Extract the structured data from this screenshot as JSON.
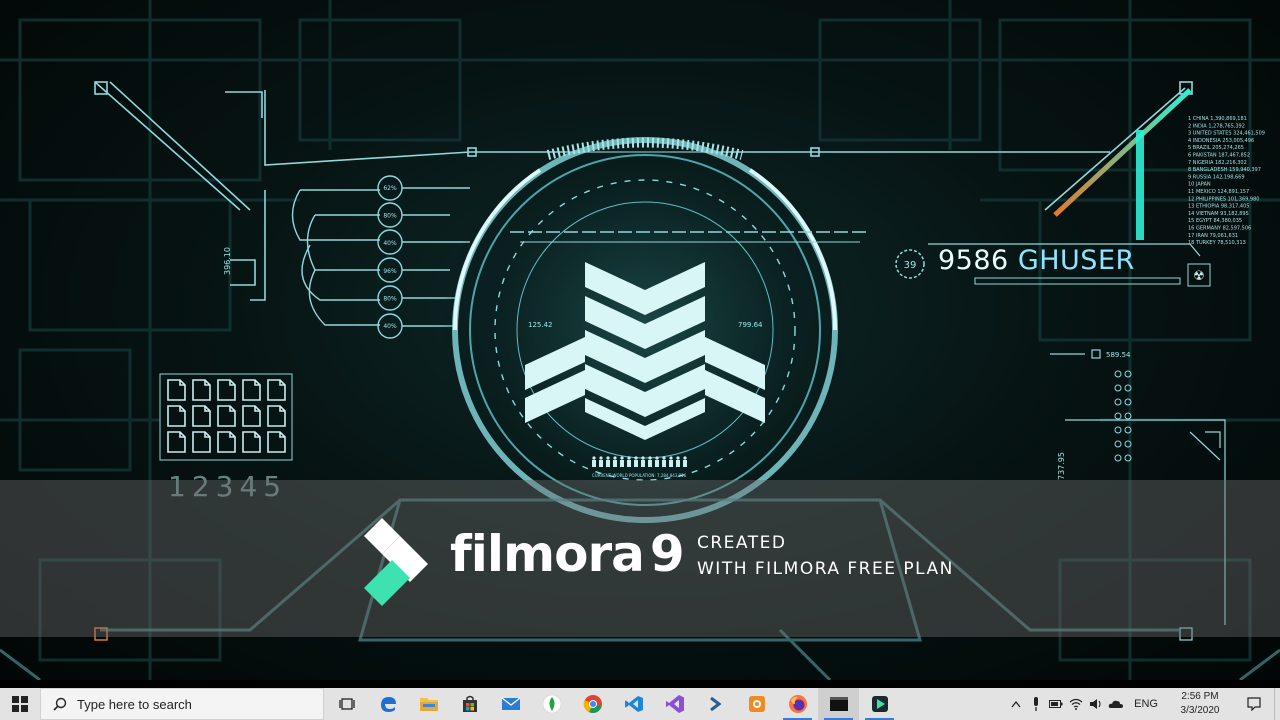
{
  "wallpaper": {
    "user_number": "9586",
    "user_name": "GHUSER",
    "level_badge": "39",
    "counter_digits": "12345",
    "left_readout": "125.42",
    "right_readout": "799.64",
    "side_value": "589.54",
    "vertical_left": "396.10",
    "vertical_right": "737.95",
    "percent_labels": [
      "62%",
      "80%",
      "40%",
      "96%",
      "80%",
      "40%"
    ],
    "population_caption": "CURRENT WORLD POPULATION: 7,284,843,916",
    "country_list": [
      "1 CHINA 1,390,869,181",
      "2 INDIA 1,278,765,392",
      "3 UNITED STATES 324,461,509",
      "4 INDONESIA 253,005,496",
      "5 BRAZIL 205,274,265",
      "6 PAKISTAN 187,467,852",
      "7 NIGERIA 182,216,302",
      "8 BANGLADESH 159,940,397",
      "9 RUSSIA 142,198,669",
      "10 JAPAN",
      "11 MEXICO 124,891,157",
      "12 PHILIPPINES 101,369,980",
      "13 ETHIOPIA 98,317,405",
      "14 VIETNAM 93,182,895",
      "15 EGYPT 84,380,035",
      "16 GERMANY 82,597,506",
      "17 IRAN 79,061,631",
      "18 TURKEY 78,510,313"
    ],
    "colors": {
      "hud_cyan": "#9fe3e6",
      "accent_teal": "#2ef0d6",
      "accent_orange": "#e07a2c"
    }
  },
  "watermark": {
    "brand": "filmora",
    "version": "9",
    "line1": "CREATED",
    "line2": "WITH FILMORA FREE PLAN",
    "colors": {
      "logo_white": "#ffffff",
      "logo_green": "#3ee2b0"
    }
  },
  "taskbar": {
    "start_icon": "windows-logo-icon",
    "search_placeholder": "Type here to search",
    "apps": [
      {
        "name": "task-view",
        "icon": "task-view-icon"
      },
      {
        "name": "edge",
        "icon": "edge-icon"
      },
      {
        "name": "file-explorer",
        "icon": "folder-icon"
      },
      {
        "name": "store",
        "icon": "store-icon"
      },
      {
        "name": "mail",
        "icon": "mail-icon"
      },
      {
        "name": "green-app",
        "icon": "leaf-icon"
      },
      {
        "name": "chrome",
        "icon": "chrome-icon"
      },
      {
        "name": "vscode",
        "icon": "vscode-icon"
      },
      {
        "name": "visual-studio",
        "icon": "visual-studio-icon"
      },
      {
        "name": "powershell",
        "icon": "powershell-icon"
      },
      {
        "name": "photo-app",
        "icon": "photo-app-icon"
      },
      {
        "name": "firefox",
        "icon": "firefox-icon"
      },
      {
        "name": "console",
        "icon": "console-icon"
      },
      {
        "name": "filmora",
        "icon": "filmora-icon"
      }
    ],
    "tray": {
      "language": "ENG",
      "time": "2:56 PM",
      "date": "3/3/2020"
    }
  }
}
